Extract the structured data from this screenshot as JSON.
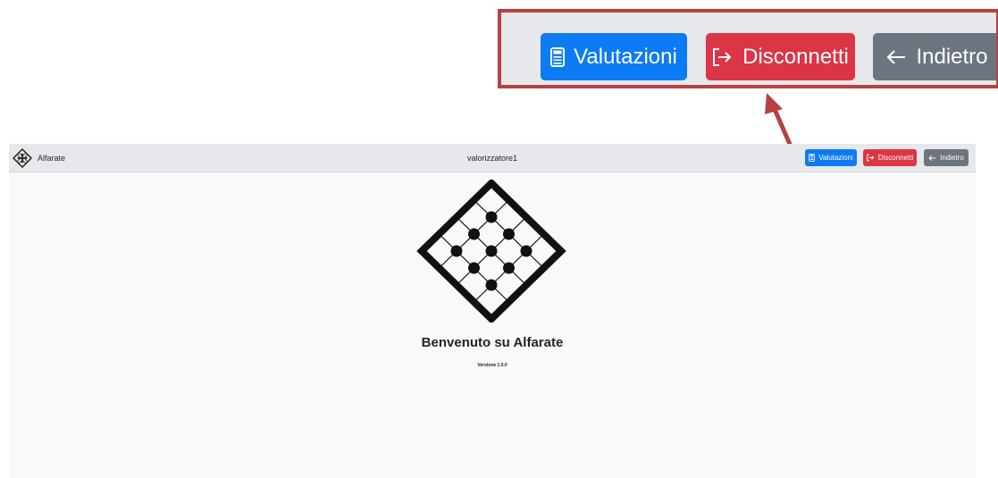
{
  "app": {
    "brand_name": "Alfarate",
    "username": "valorizzatore1",
    "welcome_title": "Benvenuto su Alfarate",
    "version_label": "Versione 1.0.0"
  },
  "toolbar": {
    "valutazioni_label": "Valutazioni",
    "disconnetti_label": "Disconnetti",
    "indietro_label": "Indietro"
  },
  "colors": {
    "primary": "#0d7bf3",
    "danger": "#dc3545",
    "secondary": "#6c757d",
    "navbar": "#e7e8eb",
    "page_background": "#f8f9fa",
    "callout_border": "#b84141"
  },
  "icons": {
    "brand": "diamond-grid-logo-icon",
    "valutazioni": "calculator-icon",
    "disconnetti": "logout-icon",
    "indietro": "arrow-left-icon"
  }
}
